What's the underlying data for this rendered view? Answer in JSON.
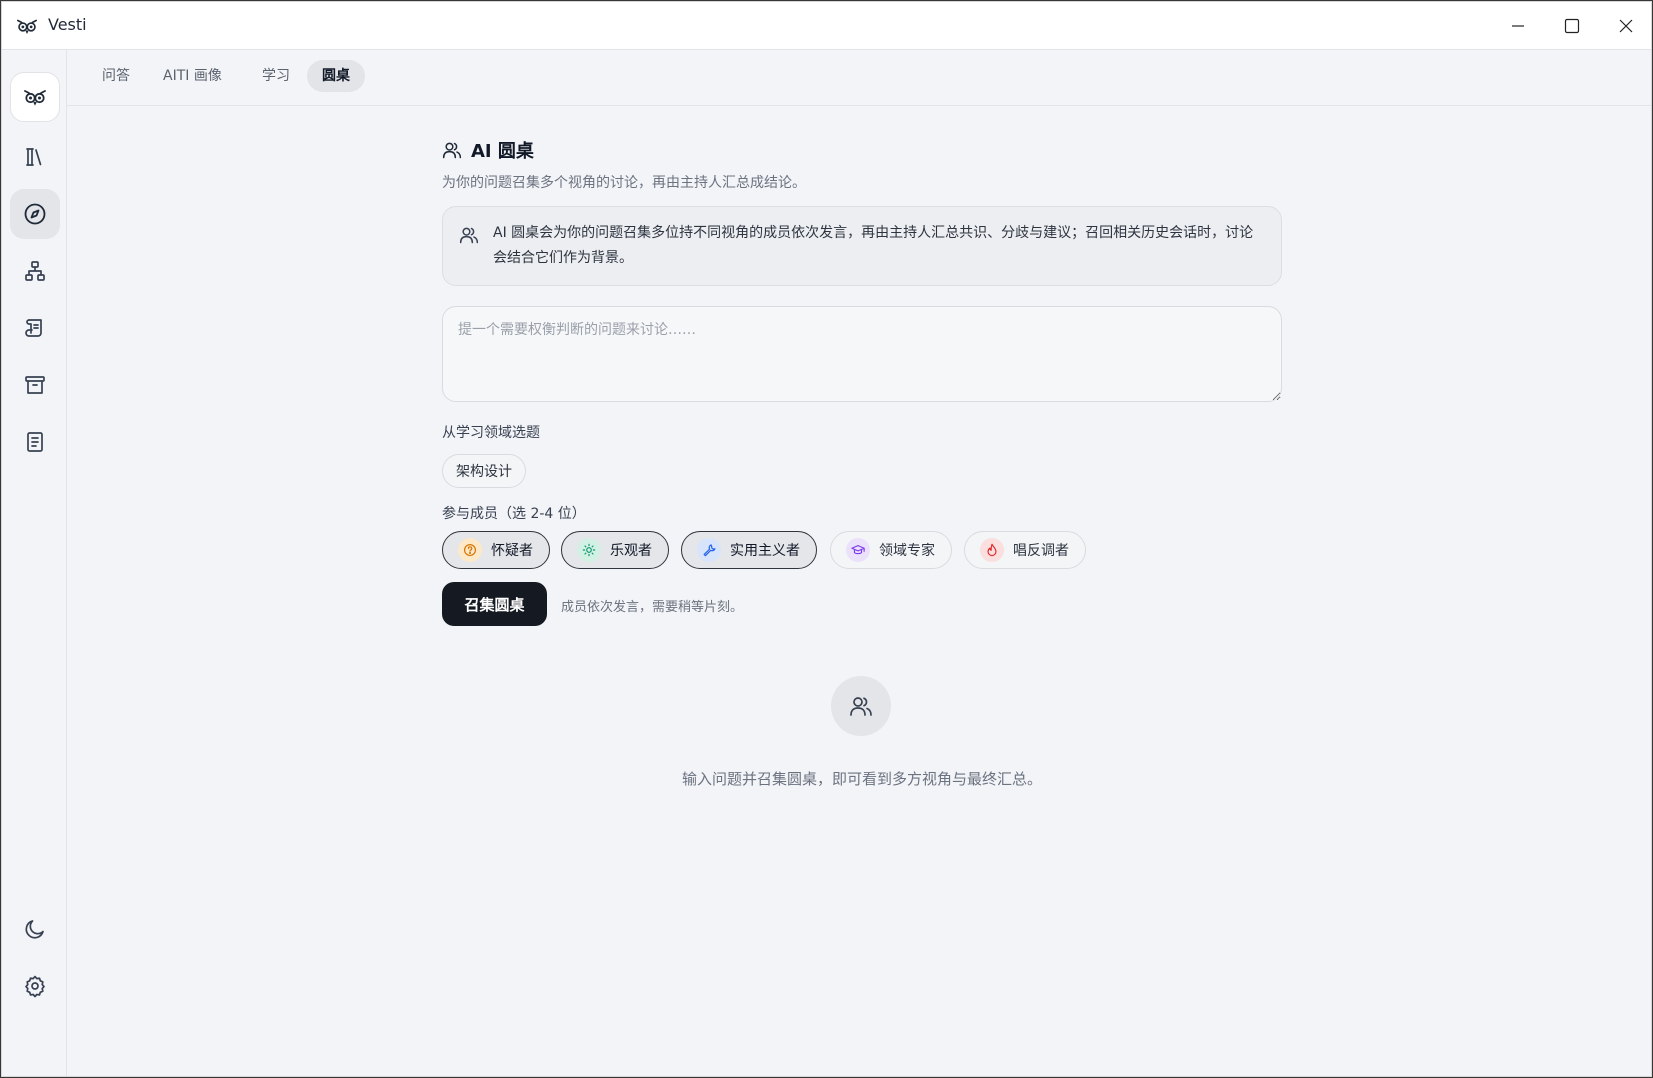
{
  "window": {
    "title": "Vesti"
  },
  "sidebar": {
    "items": [
      {
        "name": "app-logo",
        "icon": "owl-logo-icon"
      },
      {
        "name": "library",
        "icon": "library-icon"
      },
      {
        "name": "explore",
        "icon": "compass-icon",
        "active": true
      },
      {
        "name": "network",
        "icon": "sitemap-icon"
      },
      {
        "name": "scroll",
        "icon": "scroll-icon"
      },
      {
        "name": "archive",
        "icon": "archive-icon"
      },
      {
        "name": "notes",
        "icon": "notebook-icon"
      },
      {
        "name": "theme",
        "icon": "moon-icon"
      },
      {
        "name": "settings",
        "icon": "gear-icon"
      }
    ]
  },
  "tabs": [
    {
      "label": "问答",
      "active": false
    },
    {
      "label": "AITI 画像",
      "active": false
    },
    {
      "label": "学习",
      "active": false
    },
    {
      "label": "圆桌",
      "active": true
    }
  ],
  "main": {
    "title": "AI 圆桌",
    "subtitle": "为你的问题召集多个视角的讨论，再由主持人汇总成结论。",
    "info_text": "AI 圆桌会为你的问题召集多位持不同视角的成员依次发言，再由主持人汇总共识、分歧与建议；召回相关历史会话时，讨论会结合它们作为背景。",
    "question_placeholder": "提一个需要权衡判断的问题来讨论……",
    "question_value": "",
    "topic_label": "从学习领域选题",
    "topics": [
      "架构设计"
    ],
    "members_label": "参与成员（选 2-4 位）",
    "members": [
      {
        "label": "怀疑者",
        "icon": "question-circle-icon",
        "color": "#d97706",
        "bg": "#fde9c8",
        "selected": true
      },
      {
        "label": "乐观者",
        "icon": "sun-icon",
        "color": "#059669",
        "bg": "#d3f0e4",
        "selected": true
      },
      {
        "label": "实用主义者",
        "icon": "wrench-icon",
        "color": "#2563eb",
        "bg": "#d8e4fb",
        "selected": true
      },
      {
        "label": "领域专家",
        "icon": "graduation-cap-icon",
        "color": "#7c3aed",
        "bg": "#ebe1fb",
        "selected": false
      },
      {
        "label": "唱反调者",
        "icon": "flame-icon",
        "color": "#dc2626",
        "bg": "#fbdede",
        "selected": false
      }
    ],
    "convene_label": "召集圆桌",
    "hint": "成员依次发言，需要稍等片刻。",
    "empty_text": "输入问题并召集圆桌，即可看到多方视角与最终汇总。"
  }
}
